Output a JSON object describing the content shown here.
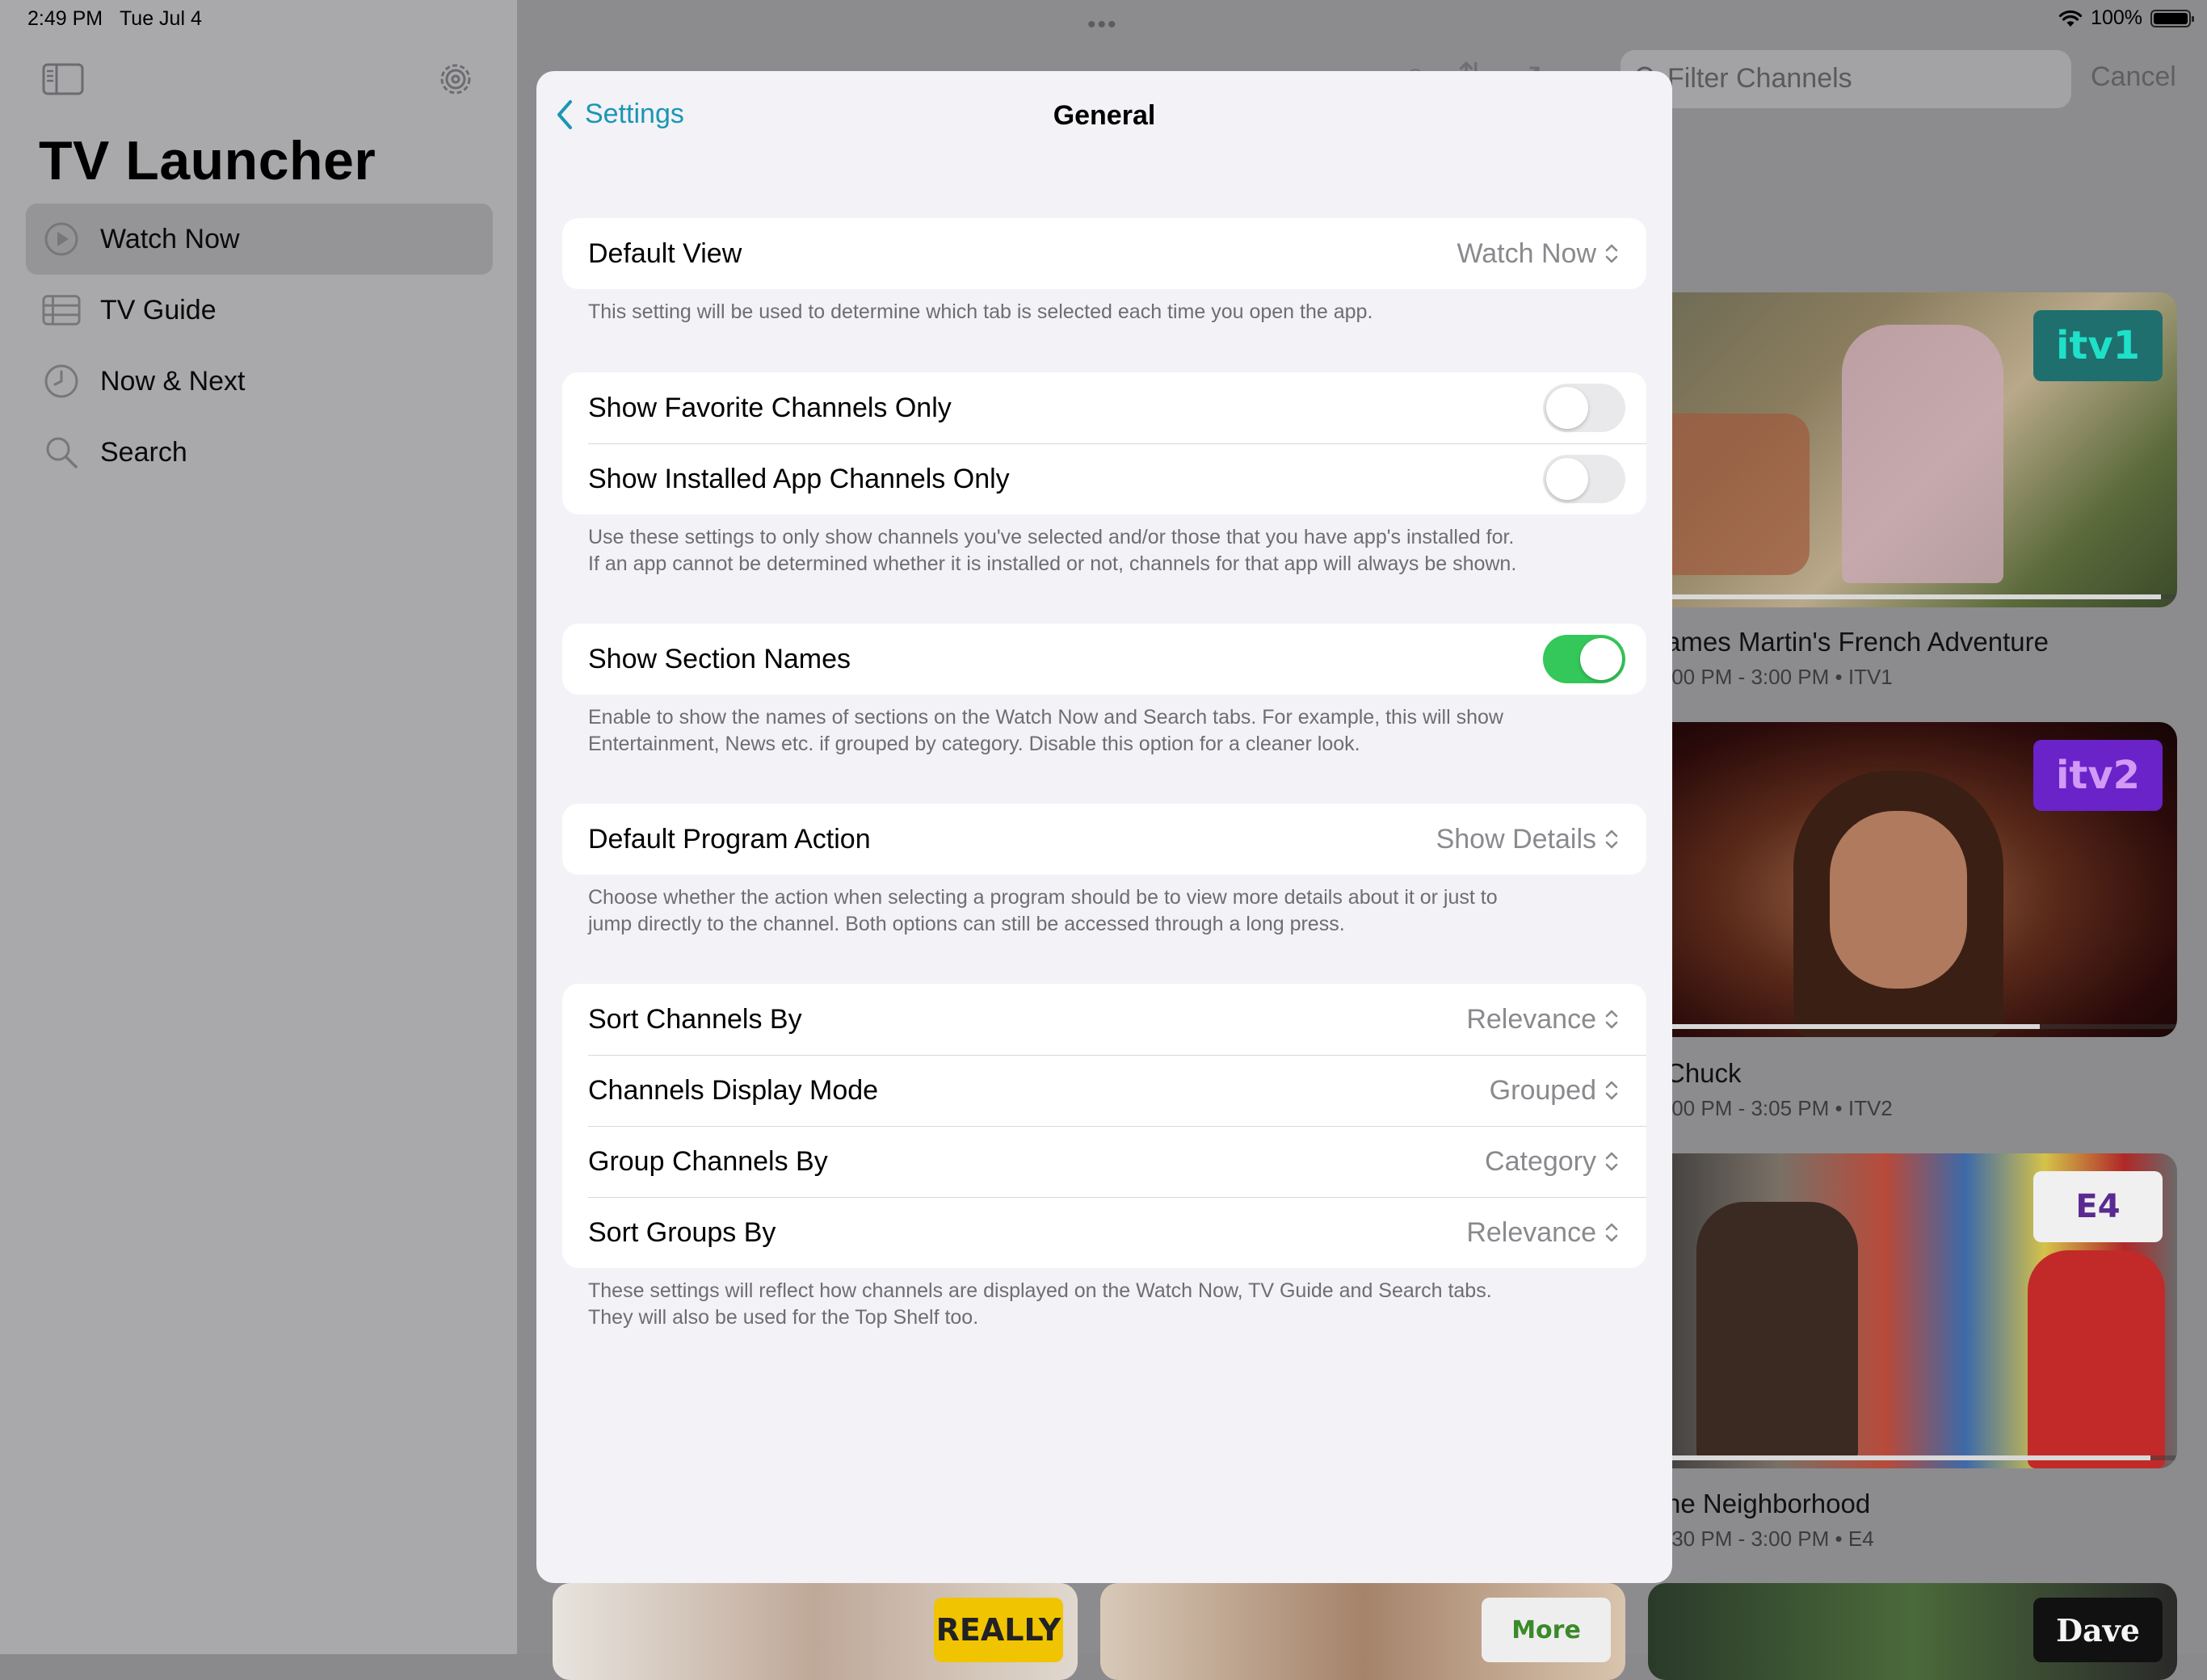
{
  "status_bar": {
    "time": "2:49 PM",
    "date": "Tue Jul 4",
    "battery": "100%"
  },
  "sidebar": {
    "app_title": "TV Launcher",
    "items": [
      {
        "label": "Watch Now",
        "icon": "play-circle-icon",
        "active": true
      },
      {
        "label": "TV Guide",
        "icon": "list-icon",
        "active": false
      },
      {
        "label": "Now & Next",
        "icon": "clock-icon",
        "active": false
      },
      {
        "label": "Search",
        "icon": "magnifier-icon",
        "active": false
      }
    ]
  },
  "toolbar": {
    "filter_placeholder": "Filter Channels",
    "cancel_label": "Cancel"
  },
  "programs": [
    {
      "title": "ames Martin's French Adventure",
      "time": ":00 PM - 3:00 PM • ITV1",
      "channel_logo": "itv1",
      "progress": 0.97
    },
    {
      "title": "Chuck",
      "time": ":00 PM - 3:05 PM • ITV2",
      "channel_logo": "itv2",
      "progress": 0.74
    },
    {
      "title": "he Neighborhood",
      "time": ":30 PM - 3:00 PM • E4",
      "channel_logo": "E4",
      "progress": 0.95
    }
  ],
  "bottom_logos": {
    "really": "REALLY",
    "more4": "More",
    "dave": "Dave"
  },
  "settings": {
    "back_label": "Settings",
    "title": "General",
    "default_view": {
      "label": "Default View",
      "value": "Watch Now",
      "footer": "This setting will be used to determine which tab is selected each time you open the app."
    },
    "filters": {
      "favorite_label": "Show Favorite Channels Only",
      "favorite_on": false,
      "installed_label": "Show Installed App Channels Only",
      "installed_on": false,
      "footer_line1": "Use these settings to only show channels you've selected and/or those that you have app's installed for.",
      "footer_line2": "If an app cannot be determined whether it is installed or not, channels for that app will always be shown."
    },
    "section_names": {
      "label": "Show Section Names",
      "on": true,
      "footer_line1": "Enable to show the names of sections on the Watch Now and Search tabs. For example, this will show",
      "footer_line2": "Entertainment, News etc. if grouped by category. Disable this option for a cleaner look."
    },
    "program_action": {
      "label": "Default Program Action",
      "value": "Show Details",
      "footer_line1": "Choose whether the action when selecting a program should be to view more details about it or just to",
      "footer_line2": "jump directly to the channel. Both options can still be accessed through a long press."
    },
    "channels": {
      "sort_label": "Sort Channels By",
      "sort_value": "Relevance",
      "display_label": "Channels Display Mode",
      "display_value": "Grouped",
      "group_label": "Group Channels By",
      "group_value": "Category",
      "sort_groups_label": "Sort Groups By",
      "sort_groups_value": "Relevance",
      "footer_line1": "These settings will reflect how channels are displayed on the Watch Now, TV Guide and Search tabs.",
      "footer_line2": "They will also be used for the Top Shelf too."
    }
  }
}
